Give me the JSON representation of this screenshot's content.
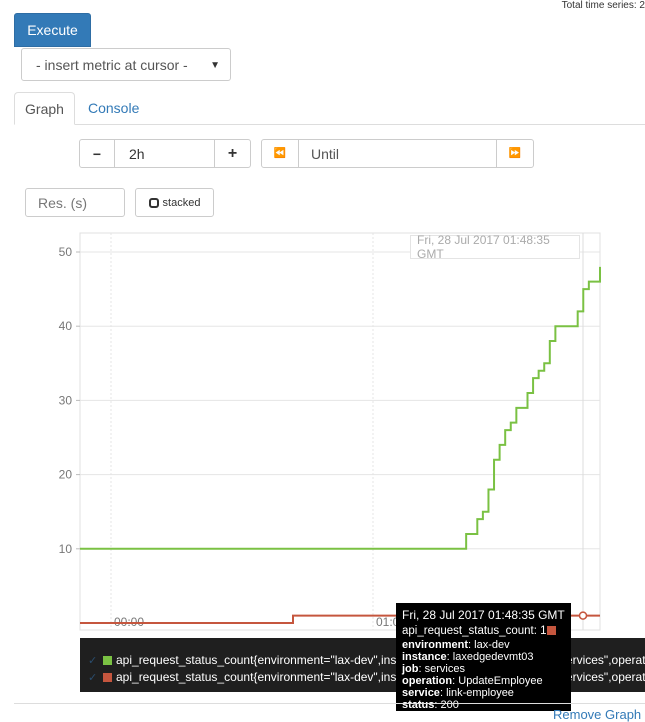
{
  "header": {
    "total_series": "Total time series: 2"
  },
  "toolbar": {
    "execute_label": "Execute",
    "metric_select_label": "- insert metric at cursor -"
  },
  "tabs": [
    {
      "label": "Graph"
    },
    {
      "label": "Console"
    }
  ],
  "controls": {
    "range_minus": "−",
    "range_value": "2h",
    "range_plus": "+",
    "until_back": "⏪",
    "until_placeholder": "Until",
    "until_forward": "⏩",
    "res_placeholder": "Res. (s)",
    "stacked_label": "stacked"
  },
  "graph": {
    "hover_date": "Fri, 28 Jul 2017 01:48:35 GMT",
    "x_ticks": [
      "00:00",
      "01:00"
    ]
  },
  "legend": {
    "items": [
      {
        "color": "#7ac143",
        "text": "api_request_status_count{environment=\"lax-dev\",instance=\"laxedgedevmt03\",job=\"services\",operation=\"GetEmployee\"}"
      },
      {
        "color": "#c5563e",
        "text": "api_request_status_count{environment=\"lax-dev\",instance=\"laxedgedevmt03\",job=\"services\",operation=\"UpdateEmployee\"}"
      }
    ]
  },
  "tooltip": {
    "title": "Fri, 28 Jul 2017 01:48:35 GMT",
    "metric_line": "api_request_status_count: 1",
    "labels": [
      {
        "key": "environment",
        "value": "lax-dev"
      },
      {
        "key": "instance",
        "value": "laxedgedevmt03"
      },
      {
        "key": "job",
        "value": "services"
      },
      {
        "key": "operation",
        "value": "UpdateEmployee"
      },
      {
        "key": "service",
        "value": "link-employee"
      },
      {
        "key": "status",
        "value": "200"
      }
    ]
  },
  "footer": {
    "remove_graph": "Remove Graph"
  },
  "chart_data": {
    "type": "line",
    "ylim": [
      0,
      52
    ],
    "y_ticks": [
      10,
      20,
      30,
      40,
      50
    ],
    "x_ticks": [
      "00:00",
      "01:00"
    ],
    "series": [
      {
        "color": "#7ac143",
        "x": [
          0,
          1,
          2,
          3,
          4,
          5,
          6,
          7,
          8,
          9,
          10,
          11,
          12,
          13,
          14,
          15,
          16,
          17,
          18,
          19,
          20,
          21,
          22,
          23,
          24,
          25,
          26
        ],
        "values": [
          10,
          10,
          12,
          12,
          14,
          15,
          18,
          22,
          24,
          26,
          27,
          29,
          29,
          31,
          33,
          34,
          35,
          38,
          40,
          40,
          40,
          40,
          42,
          45,
          46,
          46,
          48
        ]
      },
      {
        "color": "#c5563e",
        "x": [
          0,
          1,
          2,
          3
        ],
        "values": [
          0,
          0,
          1,
          1
        ]
      }
    ]
  }
}
